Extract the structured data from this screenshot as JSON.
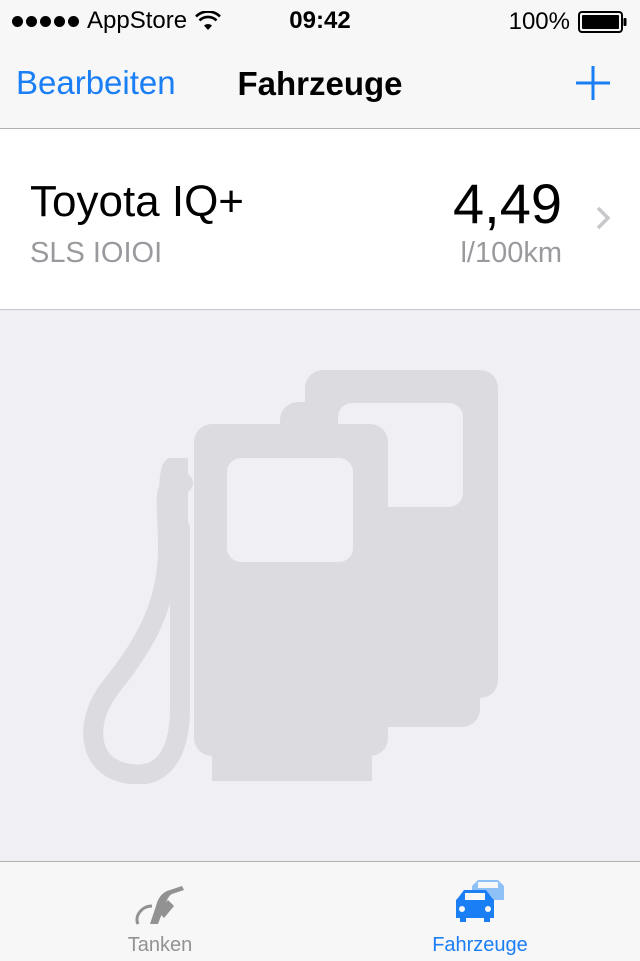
{
  "status_bar": {
    "carrier": "AppStore",
    "time": "09:42",
    "battery": "100%"
  },
  "nav": {
    "edit_label": "Bearbeiten",
    "title": "Fahrzeuge",
    "add_icon": "plus-icon"
  },
  "vehicles": [
    {
      "name": "Toyota IQ+",
      "plate": "SLS IOIOI",
      "consumption": "4,49",
      "unit": "l/100km"
    }
  ],
  "illustration": {
    "icon": "fuel-pumps-icon"
  },
  "tabs": [
    {
      "label": "Tanken",
      "icon": "fuel-nozzle-icon",
      "selected": false
    },
    {
      "label": "Fahrzeuge",
      "icon": "cars-icon",
      "selected": true
    }
  ],
  "colors": {
    "accent": "#1a7ef5",
    "background": "#efeff4",
    "secondary_text": "#9a9a9e",
    "illustration": "#dcdce0"
  }
}
